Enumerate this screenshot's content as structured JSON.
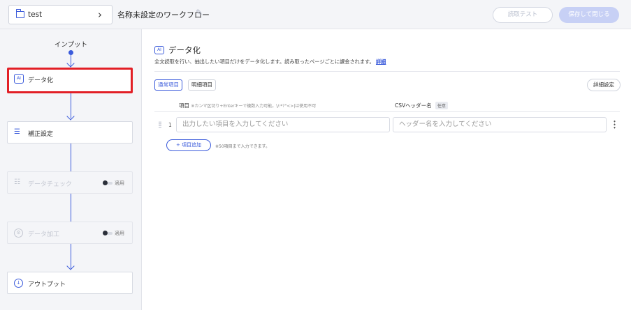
{
  "header": {
    "folder_name": "test",
    "chevron": "›",
    "workflow_title": "名称未設定のワークフロー",
    "edit_icon": "✎",
    "read_test_label": "読取テスト",
    "save_close_label": "保存して閉じる"
  },
  "flow": {
    "input_label": "インプット",
    "nodes": [
      {
        "label": "データ化",
        "icon": "ai-icon",
        "icon_text": "AI"
      },
      {
        "label": "補正設定",
        "icon": "correction-icon",
        "icon_text": "☰"
      },
      {
        "label": "データチェック",
        "icon": "checklist-icon",
        "icon_text": "☷",
        "toggle_label": "適用"
      },
      {
        "label": "データ加工",
        "icon": "process-icon",
        "icon_text": "⚙",
        "toggle_label": "適用"
      },
      {
        "label": "アウトプット",
        "icon": "output-icon",
        "icon_text": "↓"
      }
    ]
  },
  "main": {
    "title_icon": "AI",
    "title": "データ化",
    "description": "全文読取を行い、抽出したい項目だけをデータ化します。読み取ったページごとに課金されます。",
    "detail_link": "詳細",
    "tabs": [
      "通常項目",
      "明細項目"
    ],
    "detail_settings_label": "詳細設定",
    "columns": {
      "item_label": "項目",
      "item_note": "※カンマ区切り+Enterキーで複数入力可能。\\/:*?\"<>|は使用不可",
      "csv_label": "CSVヘッダー名",
      "csv_badge": "任意"
    },
    "rows": [
      {
        "number": "1",
        "item_placeholder": "出力したい項目を入力してください",
        "csv_placeholder": "ヘッダー名を入力してください"
      }
    ],
    "add_button_label": "+ 項目追加",
    "add_note": "※50項目まで入力できます。"
  }
}
